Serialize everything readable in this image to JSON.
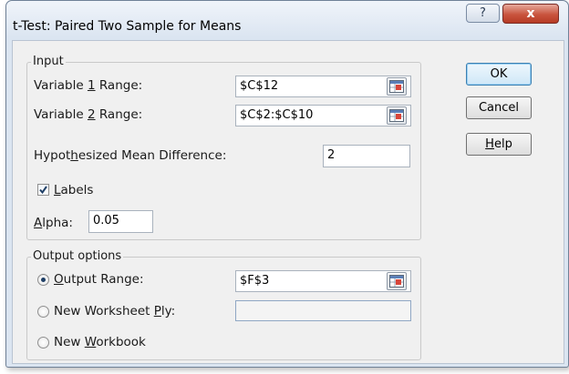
{
  "dialog": {
    "title": "t-Test: Paired Two Sample for Means",
    "help_glyph": "?",
    "close_glyph": "x"
  },
  "input": {
    "legend": "Input",
    "var1": {
      "label_pre": "Variable ",
      "label_key": "1",
      "label_post": " Range:",
      "value": "$C$12"
    },
    "var2": {
      "label_pre": "Variable ",
      "label_key": "2",
      "label_post": " Range:",
      "value": "$C$2:$C$10"
    },
    "hypothesized": {
      "label_pre": "Hypot",
      "label_key": "h",
      "label_post": "esized Mean Difference:",
      "value": "2"
    },
    "labels": {
      "label_pre": "",
      "label_key": "L",
      "label_post": "abels",
      "checked": true
    },
    "alpha": {
      "label_pre": "",
      "label_key": "A",
      "label_post": "lpha:",
      "value": "0.05"
    }
  },
  "output": {
    "legend": "Output options",
    "output_range": {
      "label_pre": "",
      "label_key": "O",
      "label_post": "utput Range:",
      "value": "$F$3",
      "selected": true
    },
    "new_ply": {
      "label_pre": "New Worksheet ",
      "label_key": "P",
      "label_post": "ly:",
      "value": "",
      "selected": false
    },
    "new_workbook": {
      "label_pre": "New ",
      "label_key": "W",
      "label_post": "orkbook",
      "selected": false
    }
  },
  "buttons": {
    "ok": "OK",
    "cancel": "Cancel",
    "help": {
      "label_key": "H",
      "label_post": "elp"
    }
  },
  "icons": {
    "refedit": "range-collapse-icon",
    "check": "checkmark-icon",
    "help": "question-mark-icon",
    "close": "close-icon"
  }
}
